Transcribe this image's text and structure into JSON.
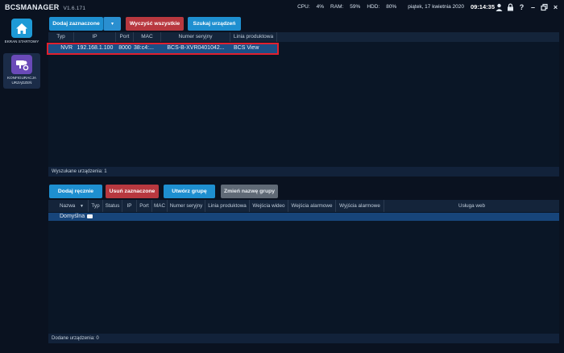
{
  "app": {
    "logo_bold": "BCS",
    "logo_rest": "MANAGER",
    "version": "V1.6.171"
  },
  "status": {
    "cpu_label": "CPU:",
    "cpu_value": "4%",
    "ram_label": "RAM:",
    "ram_value": "59%",
    "hdd_label": "HDD:",
    "hdd_value": "80%",
    "date": "piątek, 17 kwietnia 2020",
    "time": "09:14:35"
  },
  "sidebar": {
    "items": [
      {
        "label": "EKRAN STARTOWY",
        "icon": "home-icon"
      },
      {
        "label": "KONFIGURACJA URZĄDZEŃ",
        "icon": "device-config-icon"
      }
    ]
  },
  "toolbar_top": {
    "add_selected": "Dodaj zaznaczone",
    "dropdown": "▾",
    "clear_all": "Wyczyść wszystkie",
    "search_devices": "Szukaj urządzeń"
  },
  "search_table": {
    "columns": [
      "Typ",
      "IP",
      "Port",
      "MAC",
      "Numer seryjny",
      "Linia produktowa"
    ],
    "rows": [
      {
        "type": "NVR",
        "ip": "192.168.1.100",
        "port": "8000",
        "mac": "38:c4:...",
        "serial": "BCS-B-XVR0401042...",
        "line": "BCS View"
      }
    ]
  },
  "search_footer": "Wyszukane urządzenia: 1",
  "toolbar_bottom": {
    "add_manual": "Dodaj ręcznie",
    "delete_selected": "Usuń zaznaczone",
    "create_group": "Utwórz grupę",
    "rename_group": "Zmień nazwę grupy"
  },
  "added_table": {
    "columns": [
      "Nazwa",
      "Typ",
      "Status",
      "IP",
      "Port",
      "MAC",
      "Numer seryjny",
      "Linia produktowa",
      "Wejścia wideo",
      "Wejścia alarmowe",
      "Wyjścia alarmowe",
      "Usługa web"
    ],
    "sort_indicator": "▼",
    "rows": [
      {
        "name": "Domyślna"
      }
    ]
  },
  "added_footer": "Dodane urządzenia: 0",
  "colors": {
    "background": "#0a1220",
    "accent_blue": "#1e8fd0",
    "danger_red": "#b8383f",
    "disabled_gray": "#606a76",
    "highlight_red": "#e0202e"
  }
}
